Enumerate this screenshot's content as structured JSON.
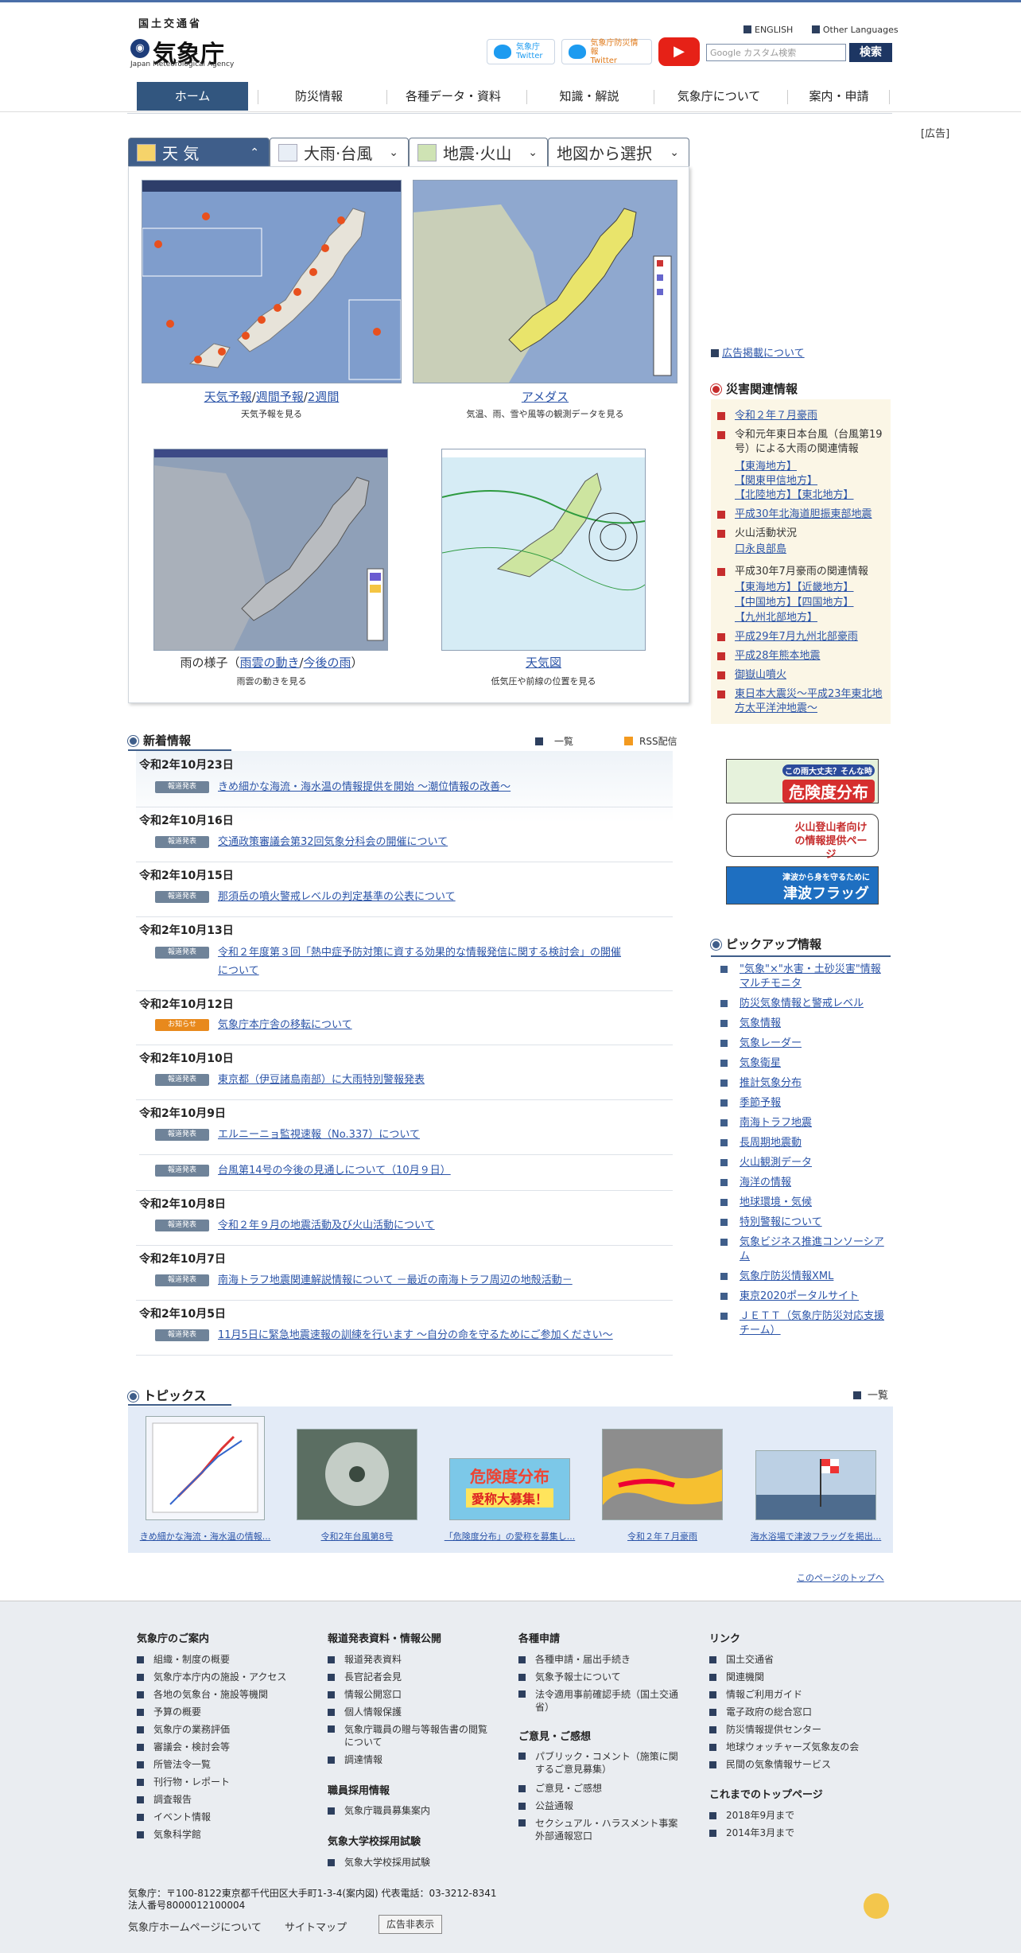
{
  "header": {
    "ministry": "国土交通省",
    "agency": "気象庁",
    "agency_en": "Japan Meteorological Agency",
    "twitter1_line1": "気象庁",
    "twitter1_line2": "Twitter",
    "twitter2_line1": "気象庁防災情報",
    "twitter2_line2": "Twitter",
    "youtube": "▶",
    "lang_en": "ENGLISH",
    "lang_other": "Other Languages",
    "search_placeholder": "Google カスタム検索",
    "search_button": "検索"
  },
  "nav": [
    "ホーム",
    "防災情報",
    "各種データ・資料",
    "知識・解説",
    "気象庁について",
    "案内・申請"
  ],
  "ad_label": "[広告]",
  "weather_tabs": [
    "天 気",
    "大雨·台風",
    "地震·火山",
    "地図から選択"
  ],
  "maps": {
    "forecast": {
      "links": [
        "天気予報",
        "週間予報",
        "2週間"
      ],
      "sep": "/",
      "sub": "天気予報を見る"
    },
    "amedas": {
      "link": "アメダス",
      "sub": "気温、雨、雪や風等の観測データを見る"
    },
    "rain": {
      "prefix": "雨の様子（",
      "link1": "雨雲の動き",
      "sep": "/",
      "link2": "今後の雨",
      "suffix": "）",
      "sub": "雨雲の動きを見る"
    },
    "chart": {
      "link": "天気図",
      "sub": "低気圧や前線の位置を見る"
    }
  },
  "ad_link": "広告掲載について",
  "disaster": {
    "title": "災害関連情報",
    "items": [
      "令和２年７月豪雨",
      "令和元年東日本台風（台風第19号）による大雨の関連情報",
      "【東海地方】",
      "【関東甲信地方】",
      "【北陸地方】【東北地方】",
      "平成30年北海道胆振東部地震",
      "火山活動状況",
      "口永良部島",
      "平成30年7月豪雨の関連情報",
      "【東海地方】【近畿地方】",
      "【中国地方】【四国地方】",
      "【九州北部地方】",
      "平成29年7月九州北部豪雨",
      "平成28年熊本地震",
      "御嶽山噴火",
      "東日本大震災～平成23年東北地方太平洋沖地震～"
    ]
  },
  "banners": [
    "この雨大丈夫？そんな時",
    "危険度分布",
    "火山登山者向けの情報提供ページ",
    "津波から身を守るために",
    "津波フラッグ"
  ],
  "pickup": {
    "title": "ピックアップ情報",
    "items": [
      "\"気象\"×\"水害・土砂災害\"情報マルチモニタ",
      "防災気象情報と警戒レベル",
      "気象情報",
      "気象レーダー",
      "気象衛星",
      "推計気象分布",
      "季節予報",
      "南海トラフ地震",
      "長周期地震動",
      "火山観測データ",
      "海洋の情報",
      "地球環境・気候",
      "特別警報について",
      "気象ビジネス推進コンソーシアム",
      "気象庁防災情報XML",
      "東京2020ポータルサイト",
      "ＪＥＴＴ（気象庁防災対応支援チーム）"
    ]
  },
  "news": {
    "title": "新着情報",
    "list": "一覧",
    "rss": "RSS配信",
    "entries": [
      {
        "date": "令和2年10月23日",
        "badge": "報道発表",
        "text": "きめ細かな海流・海水温の情報提供を開始 ～潮位情報の改善～"
      },
      {
        "date": "令和2年10月16日",
        "badge": "報道発表",
        "text": "交通政策審議会第32回気象分科会の開催について"
      },
      {
        "date": "令和2年10月15日",
        "badge": "報道発表",
        "text": "那須岳の噴火警戒レベルの判定基準の公表について"
      },
      {
        "date": "令和2年10月13日",
        "badge": "報道発表",
        "text": "令和２年度第３回「熱中症予防対策に資する効果的な情報発信に関する検討会」の開催",
        "text2": "について"
      },
      {
        "date": "令和2年10月12日",
        "badge": "お知らせ",
        "text": "気象庁本庁舎の移転について"
      },
      {
        "date": "令和2年10月10日",
        "badge": "報道発表",
        "text": "東京都（伊豆諸島南部）に大雨特別警報発表"
      },
      {
        "date": "令和2年10月9日",
        "badge": "報道発表",
        "text": "エルニーニョ監視速報（No.337）について"
      },
      {
        "date": "",
        "badge": "報道発表",
        "text": "台風第14号の今後の見通しについて（10月９日）"
      },
      {
        "date": "令和2年10月8日",
        "badge": "報道発表",
        "text": "令和２年９月の地震活動及び火山活動について"
      },
      {
        "date": "令和2年10月7日",
        "badge": "報道発表",
        "text": "南海トラフ地震関連解説情報について －最近の南海トラフ周辺の地殻活動－"
      },
      {
        "date": "令和2年10月5日",
        "badge": "報道発表",
        "text": "11月5日に緊急地震速報の訓練を行います ～自分の命を守るためにご参加ください～"
      }
    ]
  },
  "topics": {
    "title": "トピックス",
    "list": "一覧",
    "items": [
      "きめ細かな海流・海水温の情報...",
      "令和2年台風第8号",
      "「危険度分布」の愛称を募集し...",
      "令和２年７月豪雨",
      "海水浴場で津波フラッグを掲出..."
    ],
    "poster_text": "危険度分布",
    "poster_sub": "愛称大募集！"
  },
  "to_top": "このページのトップへ",
  "footer": {
    "cols": [
      {
        "title": "気象庁のご案内",
        "items": [
          "組織・制度の概要",
          "気象庁本庁内の施設・アクセス",
          "各地の気象台・施設等機関",
          "予算の概要",
          "気象庁の業務評価",
          "審議会・検討会等",
          "所管法令一覧",
          "刊行物・レポート",
          "調査報告",
          "イベント情報",
          "気象科学館"
        ]
      },
      {
        "title": "報道発表資料・情報公開",
        "items": [
          "報道発表資料",
          "長官記者会見",
          "情報公開窓口",
          "個人情報保護",
          "気象庁職員の贈与等報告書の閲覧について",
          "調達情報"
        ],
        "title2": "職員採用情報",
        "items2": [
          "気象庁職員募集案内"
        ],
        "title3": "気象大学校採用試験",
        "items3": [
          "気象大学校採用試験"
        ]
      },
      {
        "title": "各種申請",
        "items": [
          "各種申請・届出手続き",
          "気象予報士について",
          "法令適用事前確認手続（国土交通省）"
        ],
        "title2": "ご意見・ご感想",
        "items2": [
          "パブリック・コメント（施策に関するご意見募集）",
          "ご意見・ご感想",
          "公益通報",
          "セクシュアル・ハラスメント事案外部通報窓口"
        ]
      },
      {
        "title": "リンク",
        "items": [
          "国土交通省",
          "関連機関",
          "情報ご利用ガイド",
          "電子政府の総合窓口",
          "防災情報提供センター",
          "地球ウォッチャーズ気象友の会",
          "民間の気象情報サービス"
        ],
        "title2": "これまでのトップページ",
        "items2": [
          "2018年9月まで",
          "2014年3月まで"
        ]
      }
    ],
    "address": "気象庁：〒100-8122東京都千代田区大手町1-3-4(案内図) 代表電話：03-3212-8341",
    "corp": "法人番号8000012100004",
    "link1": "気象庁ホームページについて",
    "link2": "サイトマップ",
    "ad_hide": "広告非表示"
  },
  "colors": {
    "nav_active": "#32567f",
    "accent_red": "#c62d2d",
    "badge": "#6f8399",
    "badge_notice": "#e8891c"
  }
}
